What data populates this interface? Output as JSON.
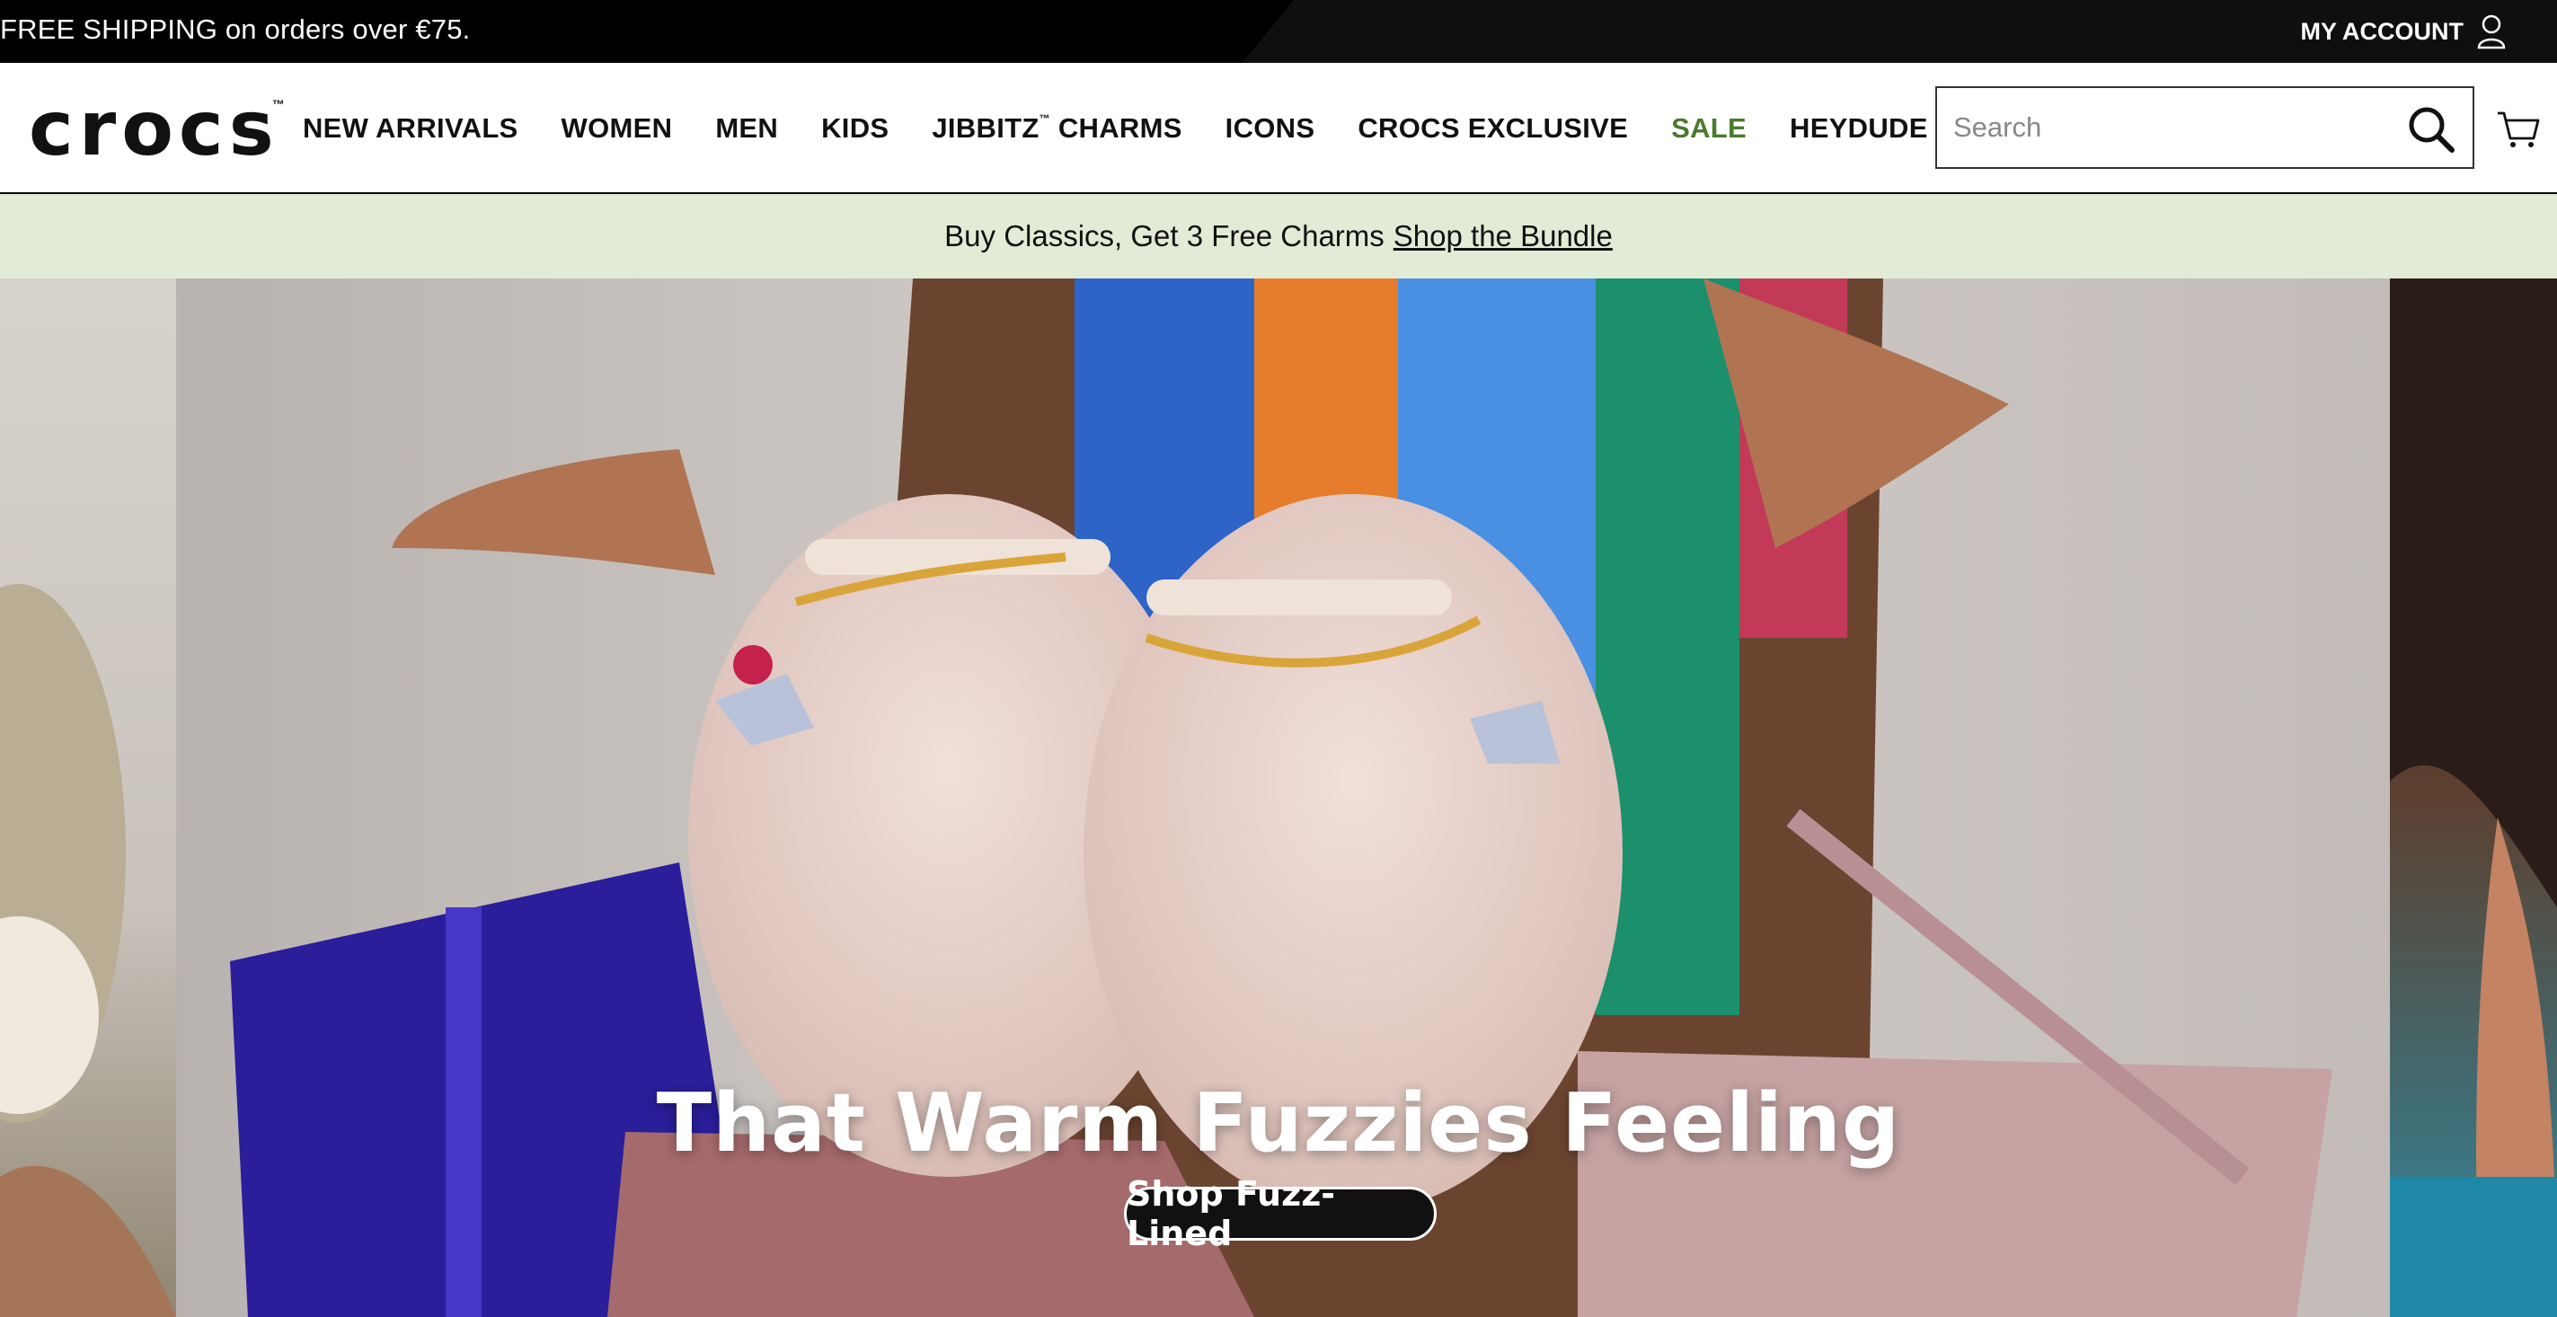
{
  "topbar": {
    "shipping_text": "FREE SHIPPING on orders over €75.",
    "account_label": "MY ACCOUNT",
    "account_icon": "user-icon"
  },
  "header": {
    "logo_text": "crocs",
    "logo_tm": "™",
    "nav": [
      {
        "label": "NEW ARRIVALS"
      },
      {
        "label": "WOMEN"
      },
      {
        "label": "MEN"
      },
      {
        "label": "KIDS"
      },
      {
        "label": "JIBBITZ",
        "suffix_tm": "™",
        "rest": " CHARMS"
      },
      {
        "label": "ICONS"
      },
      {
        "label": "CROCS EXCLUSIVE"
      },
      {
        "label": "SALE",
        "color": "#4a7a2c"
      },
      {
        "label": "HEYDUDE"
      }
    ],
    "search_placeholder": "Search",
    "search_icon": "search-icon",
    "cart_icon": "cart-icon"
  },
  "promo": {
    "text": "Buy Classics, Get 3 Free Charms",
    "link": "Shop the Bundle",
    "background": "#e2ebd6"
  },
  "hero": {
    "title": "That Warm Fuzzies Feeling",
    "button_label": "Shop Fuzz-Lined"
  }
}
